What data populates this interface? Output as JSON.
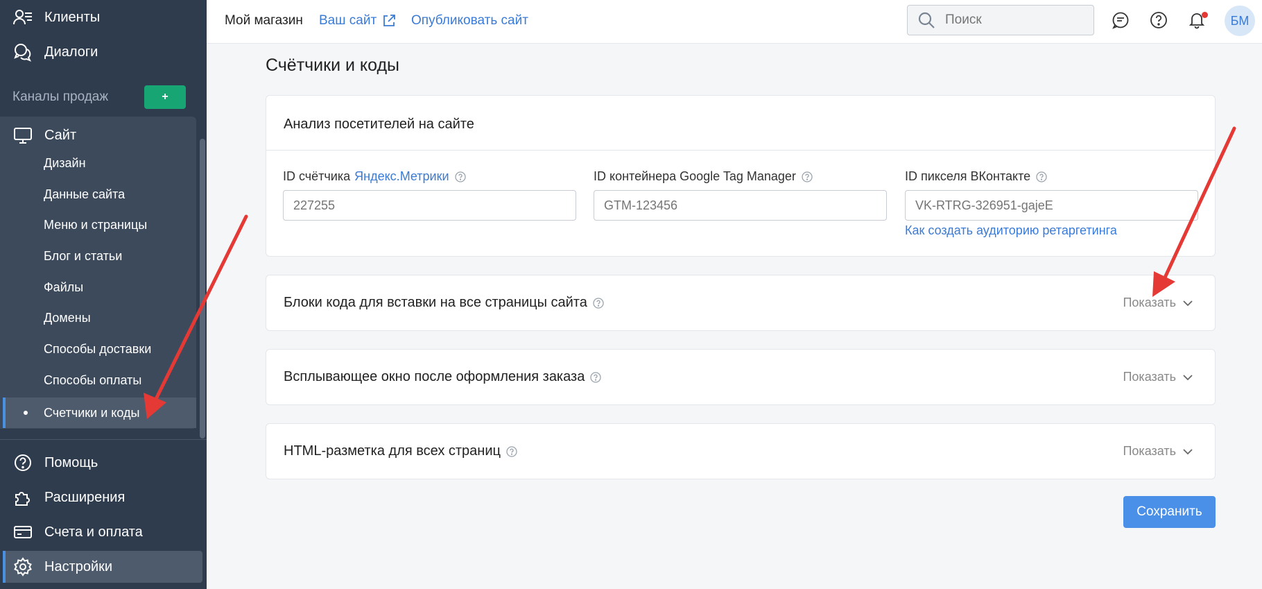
{
  "sidebar": {
    "top_items": [
      {
        "label": "Клиенты",
        "icon": "clients-icon"
      },
      {
        "label": "Диалоги",
        "icon": "dialogs-icon"
      }
    ],
    "channels_label": "Каналы продаж",
    "add_label": "+",
    "site_label": "Сайт",
    "site_items": [
      {
        "label": "Дизайн"
      },
      {
        "label": "Данные сайта"
      },
      {
        "label": "Меню и страницы"
      },
      {
        "label": "Блог и статьи"
      },
      {
        "label": "Файлы"
      },
      {
        "label": "Домены"
      },
      {
        "label": "Способы доставки"
      },
      {
        "label": "Способы оплаты"
      },
      {
        "label": "Счетчики и коды",
        "active": true
      }
    ],
    "bottom_items": [
      {
        "label": "Помощь",
        "icon": "help-icon"
      },
      {
        "label": "Расширения",
        "icon": "puzzle-icon"
      },
      {
        "label": "Счета и оплата",
        "icon": "card-icon"
      },
      {
        "label": "Настройки",
        "icon": "gear-icon"
      }
    ]
  },
  "topbar": {
    "store_name": "Мой магазин",
    "your_site": "Ваш сайт",
    "publish": "Опубликовать сайт",
    "search_placeholder": "Поиск",
    "avatar_initials": "БМ"
  },
  "main": {
    "title": "Счётчики и коды",
    "analytics": {
      "title": "Анализ посетителей на сайте",
      "yandex_label": "ID счётчика",
      "yandex_link": "Яндекс.Метрики",
      "yandex_placeholder": "227255",
      "gtm_label": "ID контейнера Google Tag Manager",
      "gtm_placeholder": "GTM-123456",
      "vk_label": "ID пикселя ВКонтакте",
      "vk_placeholder": "VK-RTRG-326951-gajeE",
      "vk_link": "Как создать аудиторию ретаргетинга"
    },
    "sections": [
      {
        "title": "Блоки кода для вставки на все страницы сайта",
        "toggle": "Показать"
      },
      {
        "title": "Всплывающее окно после оформления заказа",
        "toggle": "Показать"
      },
      {
        "title": "HTML-разметка для всех страниц",
        "toggle": "Показать"
      }
    ],
    "save_label": "Сохранить"
  },
  "colors": {
    "sidebar_bg": "#2e3c4e",
    "accent": "#3a7bd5",
    "add_button": "#17a673",
    "annotation_arrow": "#e53935"
  }
}
